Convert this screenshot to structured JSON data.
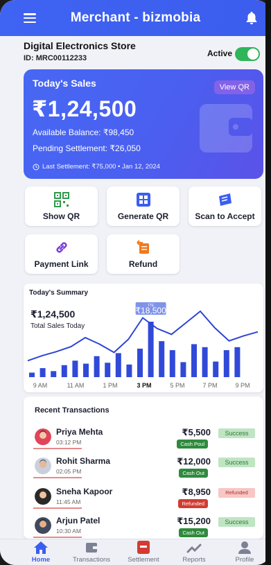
{
  "header": {
    "title": "Merchant - bizmobia",
    "menu_icon": "hamburger-menu-icon",
    "bell_icon": "bell-icon"
  },
  "store": {
    "name": "Digital Electronics Store",
    "id_label": "ID: MRC00112233",
    "status_label": "Active",
    "status_on": true
  },
  "sales_card": {
    "title": "Today's Sales",
    "view_qr": "View QR",
    "amount": "₹1,24,500",
    "available_balance": "Available Balance: ₹98,450",
    "pending_settlement": "Pending Settlement: ₹26,050",
    "last_settlement": "Last Settlement: ₹75,000 • Jan 12, 2024"
  },
  "actions": [
    {
      "label": "Show QR",
      "icon": "qr-code-icon"
    },
    {
      "label": "Generate QR",
      "icon": "generate-qr-icon"
    },
    {
      "label": "Scan to Accept",
      "icon": "scan-icon"
    },
    {
      "label": "Payment Link",
      "icon": "link-icon"
    },
    {
      "label": "Refund",
      "icon": "refund-icon"
    }
  ],
  "summary": {
    "title": "Today's Summary",
    "amount": "₹1,24,500",
    "subtitle": "Total Sales Today",
    "tooltip_small": "TTE",
    "tooltip_value": "₹18,500"
  },
  "chart_data": {
    "type": "bar",
    "x_tick_labels": [
      "9 AM",
      "11 AM",
      "1 PM",
      "3 PM",
      "5 PM",
      "7 PM",
      "9 PM"
    ],
    "values": [
      1500,
      3000,
      2000,
      4000,
      5500,
      4500,
      7000,
      4800,
      8000,
      4200,
      9500,
      18500,
      12000,
      9000,
      5000,
      11000,
      10000,
      5200,
      9000,
      10000
    ],
    "line_values": [
      20000,
      26000,
      31000,
      37000,
      48000,
      40000,
      30000,
      46000,
      72000,
      59000,
      52000,
      66000,
      80000,
      60000,
      44000,
      50000,
      55000
    ],
    "highlight_index": 11,
    "selected_tick": "3 PM",
    "colors": {
      "bar": "#3049d8",
      "line": "#2c44d4"
    }
  },
  "transactions": {
    "title": "Recent Transactions",
    "items": [
      {
        "name": "Priya Mehta",
        "time": "03:12 PM",
        "amount": "₹5,500",
        "method": "Cash Poul",
        "method_color": "#2f8a3d",
        "status": "Success",
        "avatar": "female-avatar-icon"
      },
      {
        "name": "Rohit Sharma",
        "time": "02:05 PM",
        "amount": "₹12,000",
        "method": "Cash Out",
        "method_color": "#2f8a3d",
        "status": "Success",
        "avatar": "male-avatar-icon"
      },
      {
        "name": "Sneha Kapoor",
        "time": "11:45 AM",
        "amount": "₹8,950",
        "method": "Refunded",
        "method_color": "#d23b32",
        "status": "Refunded",
        "avatar": "female-avatar-icon"
      },
      {
        "name": "Arjun Patel",
        "time": "10:30 AM",
        "amount": "₹15,200",
        "method": "Cash Out",
        "method_color": "#2f8a3d",
        "status": "Success",
        "avatar": "male-avatar-icon"
      }
    ]
  },
  "bottom_nav": [
    {
      "label": "Home",
      "icon": "home-icon",
      "active": true
    },
    {
      "label": "Transactions",
      "icon": "wallet-icon",
      "active": false
    },
    {
      "label": "Settlement",
      "icon": "settlement-icon",
      "active": false
    },
    {
      "label": "Reports",
      "icon": "reports-icon",
      "active": false
    },
    {
      "label": "Profile",
      "icon": "profile-icon",
      "active": false
    }
  ],
  "colors": {
    "primary": "#3f63f2",
    "success": "#2fb55a",
    "danger": "#d23b32"
  }
}
